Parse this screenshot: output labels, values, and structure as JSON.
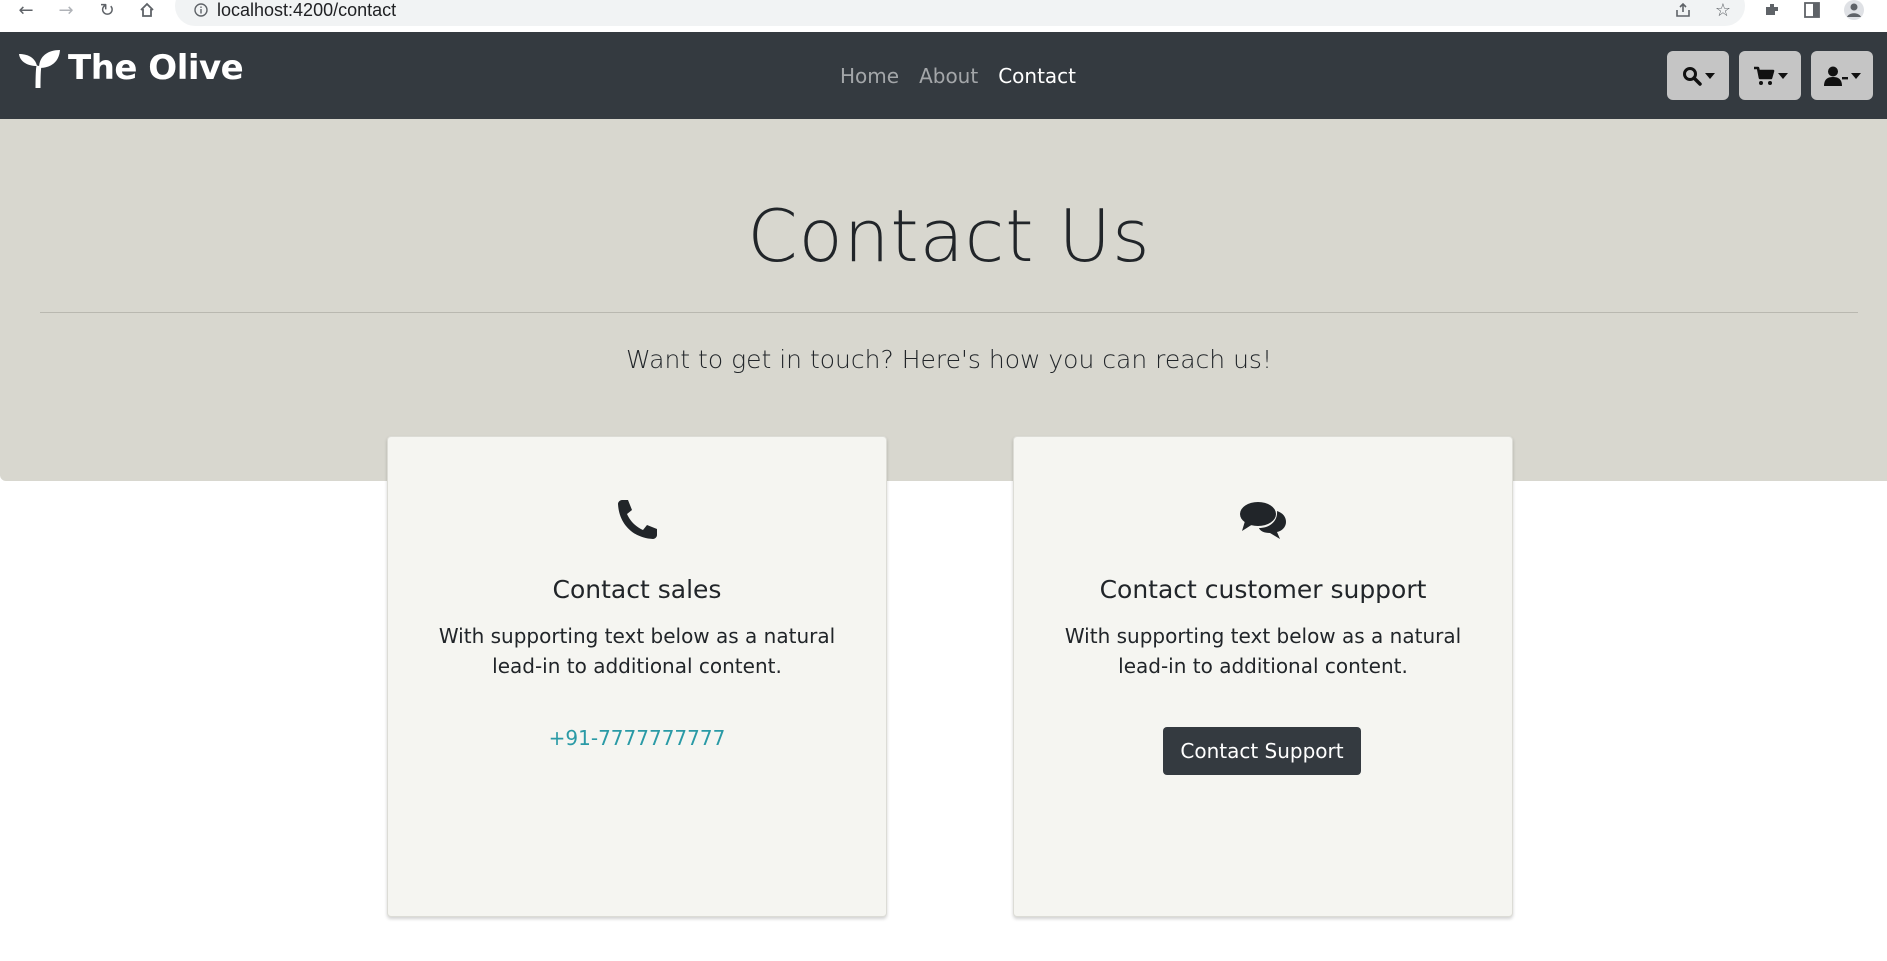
{
  "browser": {
    "url": "localhost:4200/contact"
  },
  "navbar": {
    "brand": "The Olive",
    "links": [
      {
        "label": "Home"
      },
      {
        "label": "About"
      },
      {
        "label": "Contact"
      }
    ],
    "active_link": "Contact"
  },
  "hero": {
    "title": "Contact Us",
    "lead": "Want to get in touch? Here's how you can reach us!"
  },
  "cards": [
    {
      "icon": "phone-icon",
      "title": "Contact sales",
      "text": "With supporting text below as a natural lead-in to additional content.",
      "link": "+91-7777777777"
    },
    {
      "icon": "comments-icon",
      "title": "Contact customer support",
      "text": "With supporting text below as a natural lead-in to additional content.",
      "button": "Contact Support"
    }
  ],
  "colors": {
    "navbar_bg": "#343a40",
    "hero_bg": "#d8d7cf",
    "card_bg": "#f5f5f1",
    "link": "#2a9aa6",
    "button_bg": "#343a40"
  }
}
